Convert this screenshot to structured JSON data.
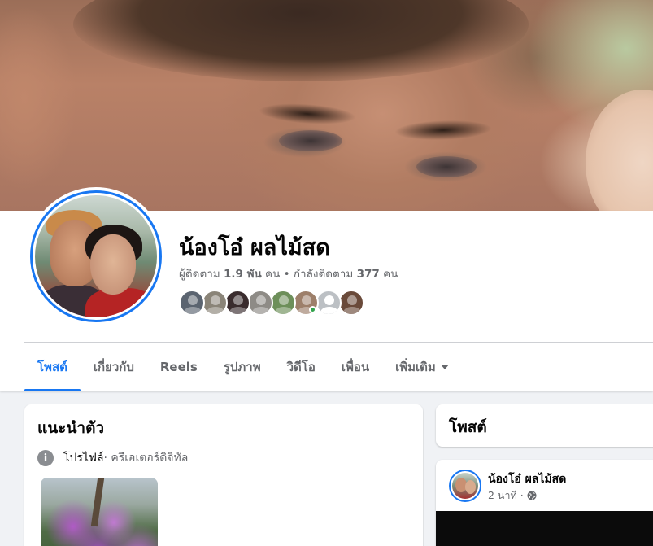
{
  "profile": {
    "name": "น้องโอ๋ ผลไม้สด",
    "followers": "1.9 พัน",
    "following": "377",
    "stats_prefix": "ผู้ติดตาม",
    "stats_unit": "คน",
    "stats_following_label": "กำลังติดตาม",
    "stats_separator": "•"
  },
  "friend_avatars": [
    {
      "color": "#5b6470",
      "online": false
    },
    {
      "color": "#8a8478",
      "online": false
    },
    {
      "color": "#3a2c2e",
      "online": false
    },
    {
      "color": "#8e8b86",
      "online": false
    },
    {
      "color": "#6d8f5a",
      "online": false
    },
    {
      "color": "#9d7f6a",
      "online": true
    },
    {
      "color": "#bcc0c4",
      "online": false
    },
    {
      "color": "#6a4a3a",
      "online": false
    }
  ],
  "tabs": [
    {
      "label": "โพสต์",
      "active": true
    },
    {
      "label": "เกี่ยวกับ",
      "active": false
    },
    {
      "label": "Reels",
      "active": false
    },
    {
      "label": "รูปภาพ",
      "active": false
    },
    {
      "label": "วิดีโอ",
      "active": false
    },
    {
      "label": "เพื่อน",
      "active": false
    },
    {
      "label": "เพิ่มเติม",
      "active": false
    }
  ],
  "intro": {
    "title": "แนะนำตัว",
    "profile_label": "โปรไฟล์",
    "profile_category": " · ครีเอเตอร์ดิจิทัล"
  },
  "posts": {
    "title": "โพสต์",
    "first_post": {
      "author": "น้องโอ๋ ผลไม้สด",
      "time": "2 นาที ·"
    }
  },
  "colors": {
    "accent": "#1877f2",
    "secondary_text": "#65676b",
    "background": "#f0f2f5"
  }
}
